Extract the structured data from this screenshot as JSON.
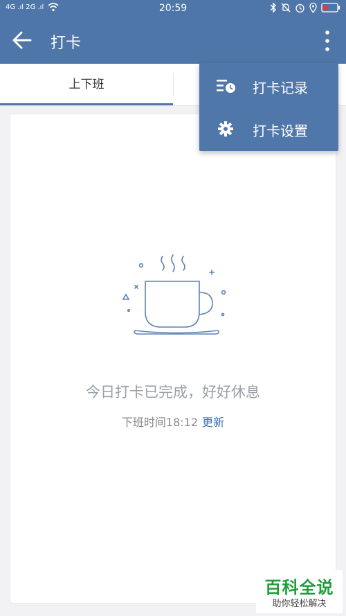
{
  "status_bar": {
    "signal_left": "4G .ıl 2G .ıl",
    "time": "20:59"
  },
  "app_bar": {
    "title": "打卡"
  },
  "tabs": [
    {
      "label": "上下班",
      "active": true
    },
    {
      "label": "",
      "active": false
    }
  ],
  "menu": {
    "items": [
      {
        "label": "打卡记录",
        "icon": "record-list-icon"
      },
      {
        "label": "打卡设置",
        "icon": "gear-icon"
      }
    ]
  },
  "main": {
    "status_message": "今日打卡已完成，好好休息",
    "clock_out_text": "下班时间18:12",
    "update_link": "更新"
  },
  "watermark": {
    "title": "百科全说",
    "subtitle": "助你轻松解决"
  },
  "colors": {
    "primary": "#4f76a8",
    "menu_bg": "#5077aa",
    "link": "#3a6db5",
    "watermark_green": "#1f9e3c"
  }
}
